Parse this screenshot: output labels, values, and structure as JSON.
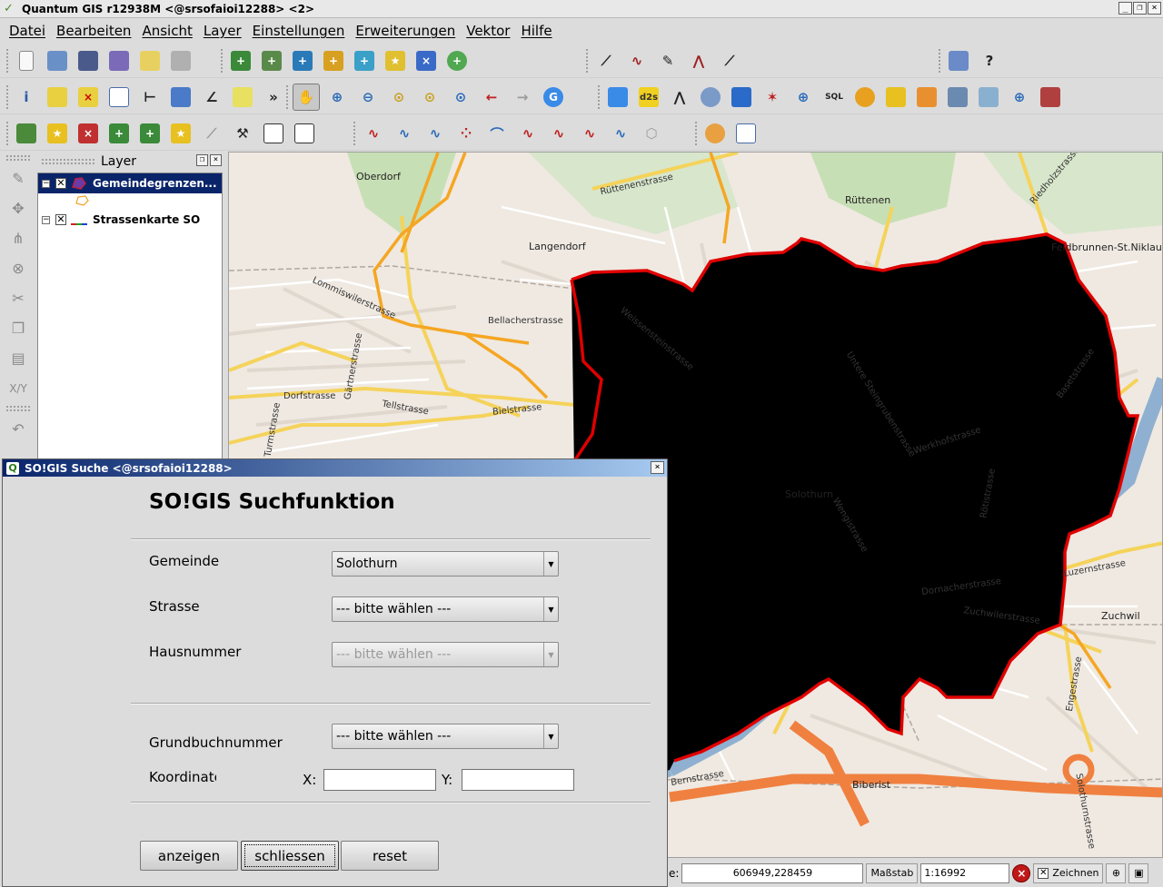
{
  "window": {
    "title": "Quantum GIS r12938M <@srsofaioi12288> <2>",
    "controls": [
      "_",
      "❐",
      "×"
    ]
  },
  "menubar": [
    "Datei",
    "Bearbeiten",
    "Ansicht",
    "Layer",
    "Einstellungen",
    "Erweiterungen",
    "Vektor",
    "Hilfe"
  ],
  "toolbars": {
    "overflow_glyph": "»",
    "sql_label": "SQL",
    "d2s_label": "d2s"
  },
  "edit_toolbar": {
    "xy_label": "X/Y"
  },
  "layer_panel": {
    "title": "Layer",
    "layers": [
      {
        "name": "Gemeindegrenzen...",
        "visible": true,
        "selected": true
      },
      {
        "name": "Strassenkarte SO",
        "visible": true,
        "selected": false
      }
    ]
  },
  "map": {
    "places": [
      "Oberdorf",
      "Langendorf",
      "Rüttenen",
      "Feldbrunnen-St.Niklaus",
      "Solothurn",
      "Zuchwil",
      "Biberist"
    ],
    "streets": [
      "Rüttenenstrasse",
      "Riedholzstrasse",
      "Lommiswilerstrasse",
      "Bellacherstrasse",
      "Weissensteinstrasse",
      "Gärtnerstrasse",
      "Dorfstrasse",
      "Tellstrasse",
      "Bielstrasse",
      "Turmstrasse",
      "Untere Steingrubenstrasse",
      "Basetstrasse",
      "Werkhofstrasse",
      "Rötistrasse",
      "Wengistrasse",
      "Dornacherstrasse",
      "Luzernstrasse",
      "Zuchwilerstrasse",
      "Engestrasse",
      "Solothurnstrasse",
      "Bernstrasse"
    ],
    "colors": {
      "background": "#efe9e1",
      "river": "#8fb0d0",
      "boundary": "#e00000",
      "main_road": "#f5d35a",
      "primary_road": "#f5a623",
      "motorway": "#f08040",
      "green": "#c7dfb5"
    }
  },
  "statusbar": {
    "coord_prefix": "e:",
    "coordinates": "606949,228459",
    "scale_label": "Maßstab",
    "scale_value": "1:16992",
    "render_label": "Zeichnen",
    "render_checked": true
  },
  "dialog": {
    "title": "SO!GIS Suche <@srsofaioi12288>",
    "heading": "SO!GIS Suchfunktion",
    "gemeinde_label": "Gemeinde",
    "gemeinde_value": "Solothurn",
    "strasse_label": "Strasse",
    "strasse_value": "--- bitte wählen ---",
    "hausnummer_label": "Hausnummer",
    "hausnummer_value": "--- bitte wählen ---",
    "grundbuch_label": "Grundbuchnummer",
    "grundbuch_value": "--- bitte wählen ---",
    "koordinate_label": "Koordinate",
    "x_label": "X:",
    "y_label": "Y:",
    "x_value": "",
    "y_value": "",
    "buttons": {
      "show": "anzeigen",
      "close": "schliessen",
      "reset": "reset"
    }
  }
}
